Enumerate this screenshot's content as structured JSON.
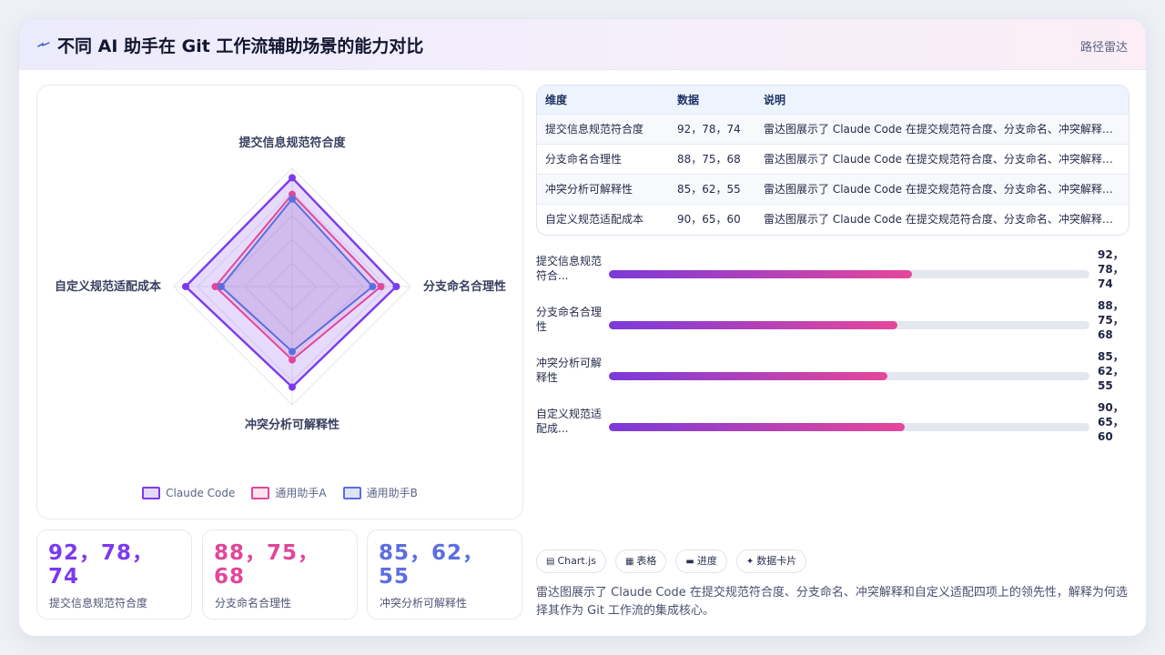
{
  "header": {
    "icon": "lightning-icon",
    "title": "不同 AI 助手在 Git 工作流辅助场景的能力对比",
    "tag": "路径雷达"
  },
  "chart_data": {
    "type": "radar",
    "axes": [
      "提交信息规范符合度",
      "分支命名合理性",
      "冲突分析可解释性",
      "自定义规范适配成本"
    ],
    "range": [
      0,
      100
    ],
    "series": [
      {
        "name": "Claude Code",
        "values": [
          92,
          88,
          85,
          90
        ],
        "color": "#7c3aed"
      },
      {
        "name": "通用助手A",
        "values": [
          78,
          75,
          62,
          65
        ],
        "color": "#e0479a"
      },
      {
        "name": "通用助手B",
        "values": [
          74,
          68,
          55,
          60
        ],
        "color": "#5b6ee1"
      }
    ],
    "legend": "bottom"
  },
  "stats": [
    {
      "value": "92，78，74",
      "label": "提交信息规范符合度",
      "color": "#7c3aed"
    },
    {
      "value": "88，75，68",
      "label": "分支命名合理性",
      "color": "#e0479a"
    },
    {
      "value": "85，62，55",
      "label": "冲突分析可解释性",
      "color": "#5b6ee1"
    }
  ],
  "table": {
    "headers": [
      "维度",
      "数据",
      "说明"
    ],
    "rows": [
      {
        "dim": "提交信息规范符合度",
        "data": "92，78，74",
        "note": "雷达图展示了 Claude Code 在提交规范符合度、分支命名、冲突解释和自定义适配四项上的领先性"
      },
      {
        "dim": "分支命名合理性",
        "data": "88，75，68",
        "note": "雷达图展示了 Claude Code 在提交规范符合度、分支命名、冲突解释和自定义适配四项上的领先性"
      },
      {
        "dim": "冲突分析可解释性",
        "data": "85，62，55",
        "note": "雷达图展示了 Claude Code 在提交规范符合度、分支命名、冲突解释和自定义适配四项上的领先性"
      },
      {
        "dim": "自定义规范适配成本",
        "data": "90，65，60",
        "note": "雷达图展示了 Claude Code 在提交规范符合度、分支命名、冲突解释和自定义适配四项上的领先性"
      }
    ]
  },
  "progress": [
    {
      "label": "提交信息规范符合...",
      "value": "92，78，74",
      "fill": 0.63
    },
    {
      "label": "分支命名合理性",
      "value": "88，75，68",
      "fill": 0.6
    },
    {
      "label": "冲突分析可解释性",
      "value": "85，62，55",
      "fill": 0.58
    },
    {
      "label": "自定义规范适配成...",
      "value": "90，65，60",
      "fill": 0.616
    }
  ],
  "chips": [
    {
      "icon": "chart-icon",
      "glyph": "▤",
      "label": "Chart.js"
    },
    {
      "icon": "table-icon",
      "glyph": "▦",
      "label": "表格"
    },
    {
      "icon": "progress-icon",
      "glyph": "▬",
      "label": "进度"
    },
    {
      "icon": "sparkle-icon",
      "glyph": "✦",
      "label": "数据卡片"
    }
  ],
  "description": "雷达图展示了 Claude Code 在提交规范符合度、分支命名、冲突解释和自定义适配四项上的领先性，解释为何选择其作为 Git 工作流的集成核心。"
}
